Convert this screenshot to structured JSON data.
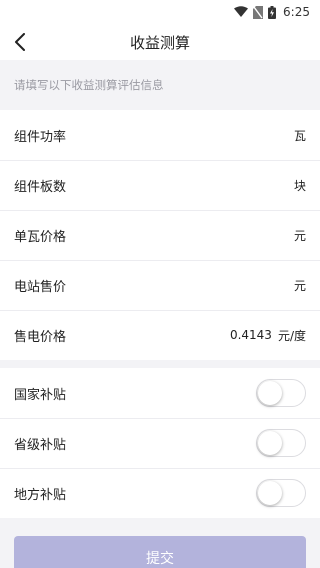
{
  "status_bar": {
    "time": "6:25"
  },
  "header": {
    "title": "收益测算"
  },
  "hint": "请填写以下收益测算评估信息",
  "inputs": [
    {
      "label": "组件功率",
      "value": "",
      "unit": "瓦"
    },
    {
      "label": "组件板数",
      "value": "",
      "unit": "块"
    },
    {
      "label": "单瓦价格",
      "value": "",
      "unit": "元"
    },
    {
      "label": "电站售价",
      "value": "",
      "unit": "元"
    },
    {
      "label": "售电价格",
      "value": "0.4143",
      "unit": "元/度"
    }
  ],
  "subsidies": [
    {
      "label": "国家补贴",
      "enabled": false
    },
    {
      "label": "省级补贴",
      "enabled": false
    },
    {
      "label": "地方补贴",
      "enabled": false
    }
  ],
  "submit_label": "提交",
  "colors": {
    "submit_bg": "#b3b3dc",
    "page_bg": "#f3f3f6"
  }
}
